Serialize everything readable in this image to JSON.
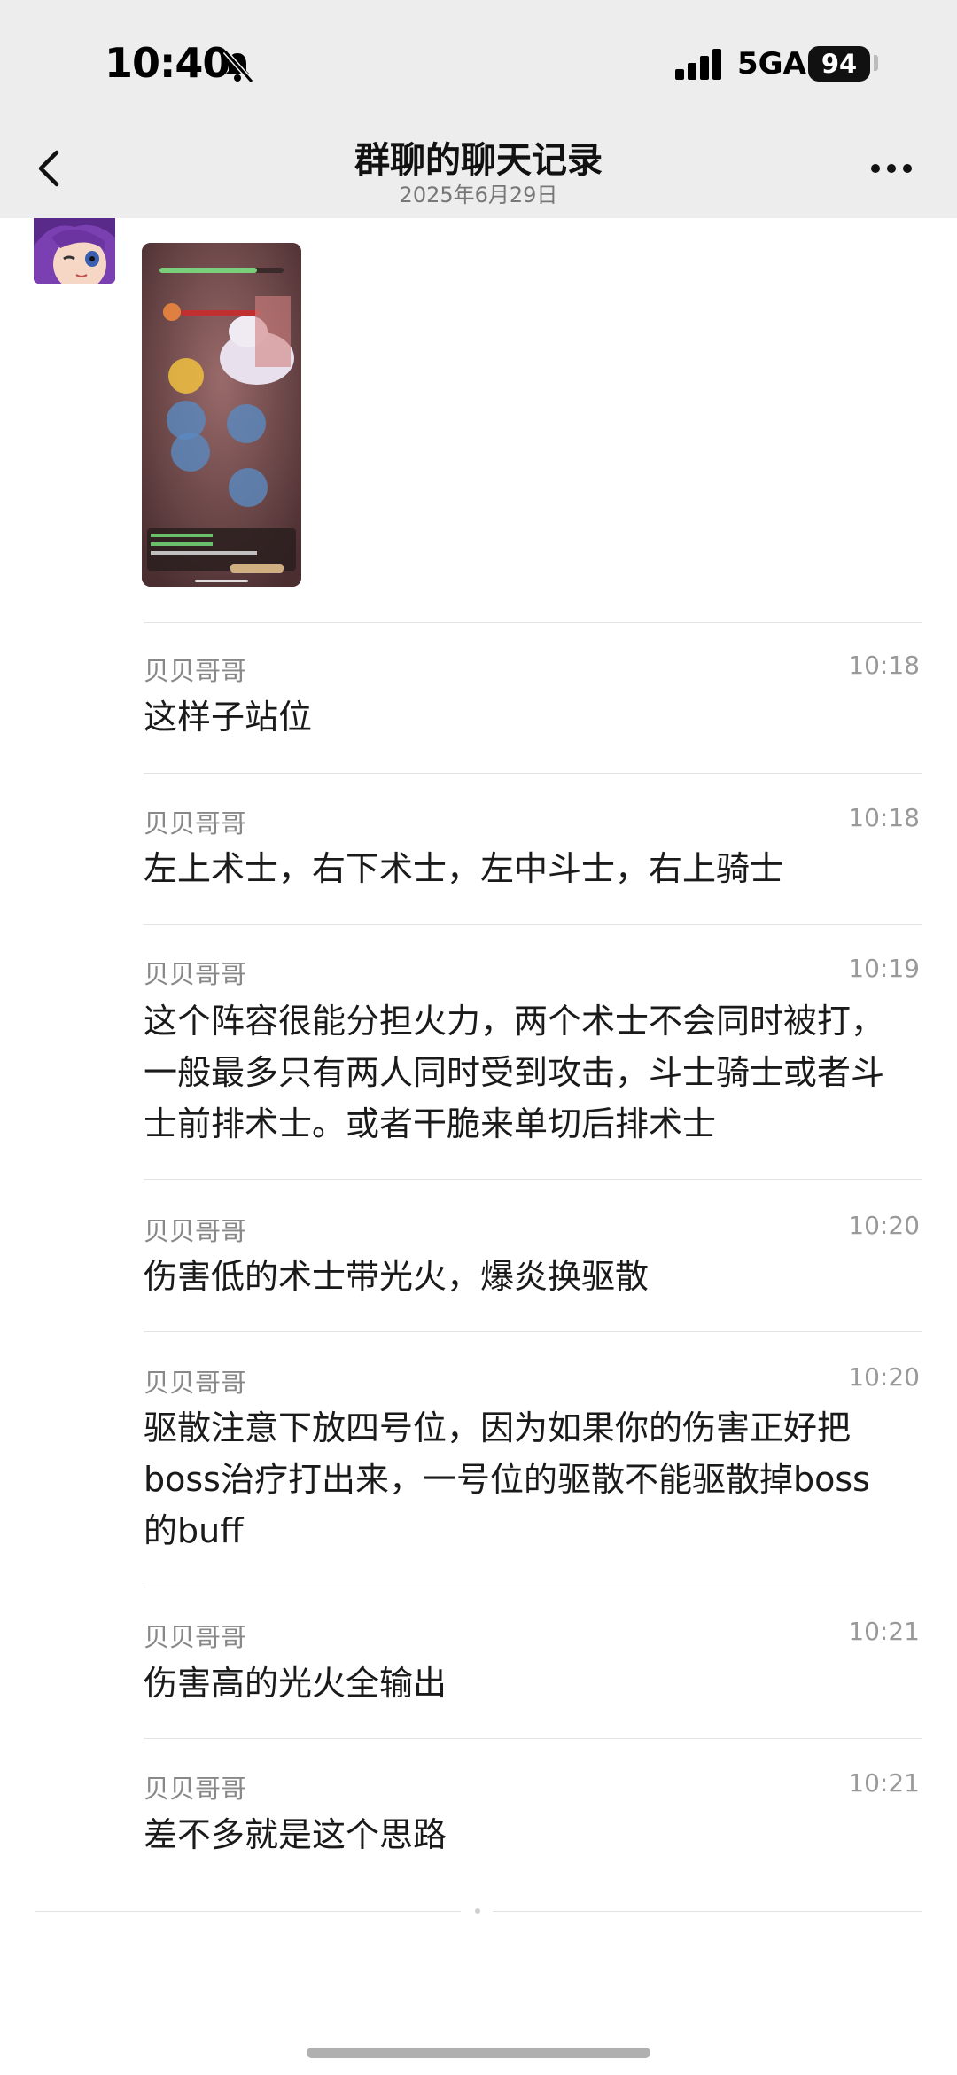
{
  "status_bar": {
    "time": "10:40",
    "network": "5GA",
    "battery": "94"
  },
  "header": {
    "title": "群聊的聊天记录",
    "date": "2025年6月29日"
  },
  "image_message": {
    "image": "game-screenshot",
    "alt_icon": "game-battle-scene"
  },
  "messages": [
    {
      "name": "贝贝哥哥",
      "time": "10:18",
      "text": "这样子站位"
    },
    {
      "name": "贝贝哥哥",
      "time": "10:18",
      "text": "左上术士，右下术士，左中斗士，右上骑士"
    },
    {
      "name": "贝贝哥哥",
      "time": "10:19",
      "lines": [
        "这个阵容很能分担火力，两个术士不会同时被打，",
        "一般最多只有两人同时受到攻击，斗士骑士或者斗",
        "士前排术士。或者干脆来单切后排术士"
      ]
    },
    {
      "name": "贝贝哥哥",
      "time": "10:20",
      "text": "伤害低的术士带光火，爆炎换驱散"
    },
    {
      "name": "贝贝哥哥",
      "time": "10:20",
      "lines": [
        "驱散注意下放四号位，因为如果你的伤害正好把",
        "boss治疗打出来，一号位的驱散不能驱散掉boss",
        "的buff"
      ]
    },
    {
      "name": "贝贝哥哥",
      "time": "10:21",
      "text": "伤害高的光火全输出"
    },
    {
      "name": "贝贝哥哥",
      "time": "10:21",
      "text": "差不多就是这个思路"
    }
  ]
}
